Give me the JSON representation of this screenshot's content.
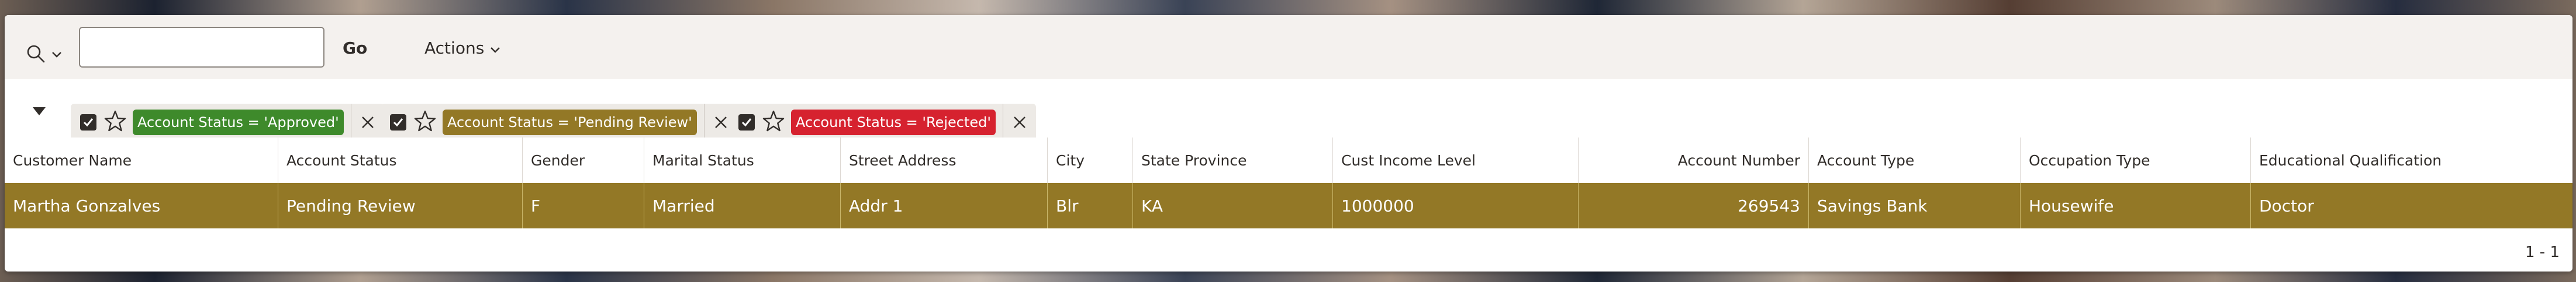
{
  "toolbar": {
    "search_placeholder": "",
    "search_value": "",
    "go_label": "Go",
    "actions_label": "Actions"
  },
  "filters": [
    {
      "label": "Account Status = 'Approved'",
      "color": "#3e8a2b"
    },
    {
      "label": "Account Status = 'Pending Review'",
      "color": "#937826"
    },
    {
      "label": "Account Status = 'Rejected'",
      "color": "#d6222f"
    }
  ],
  "table": {
    "columns": [
      "Customer Name",
      "Account Status",
      "Gender",
      "Marital Status",
      "Street Address",
      "City",
      "State Province",
      "Cust Income Level",
      "Account Number",
      "Account Type",
      "Occupation Type",
      "Educational Qualification"
    ],
    "rows": [
      [
        "Martha Gonzalves",
        "Pending Review",
        "F",
        "Married",
        "Addr 1",
        "Blr",
        "KA",
        "1000000",
        "269543",
        "Savings Bank",
        "Housewife",
        "Doctor"
      ]
    ],
    "row_color": "#937826"
  },
  "pagination": "1 - 1"
}
